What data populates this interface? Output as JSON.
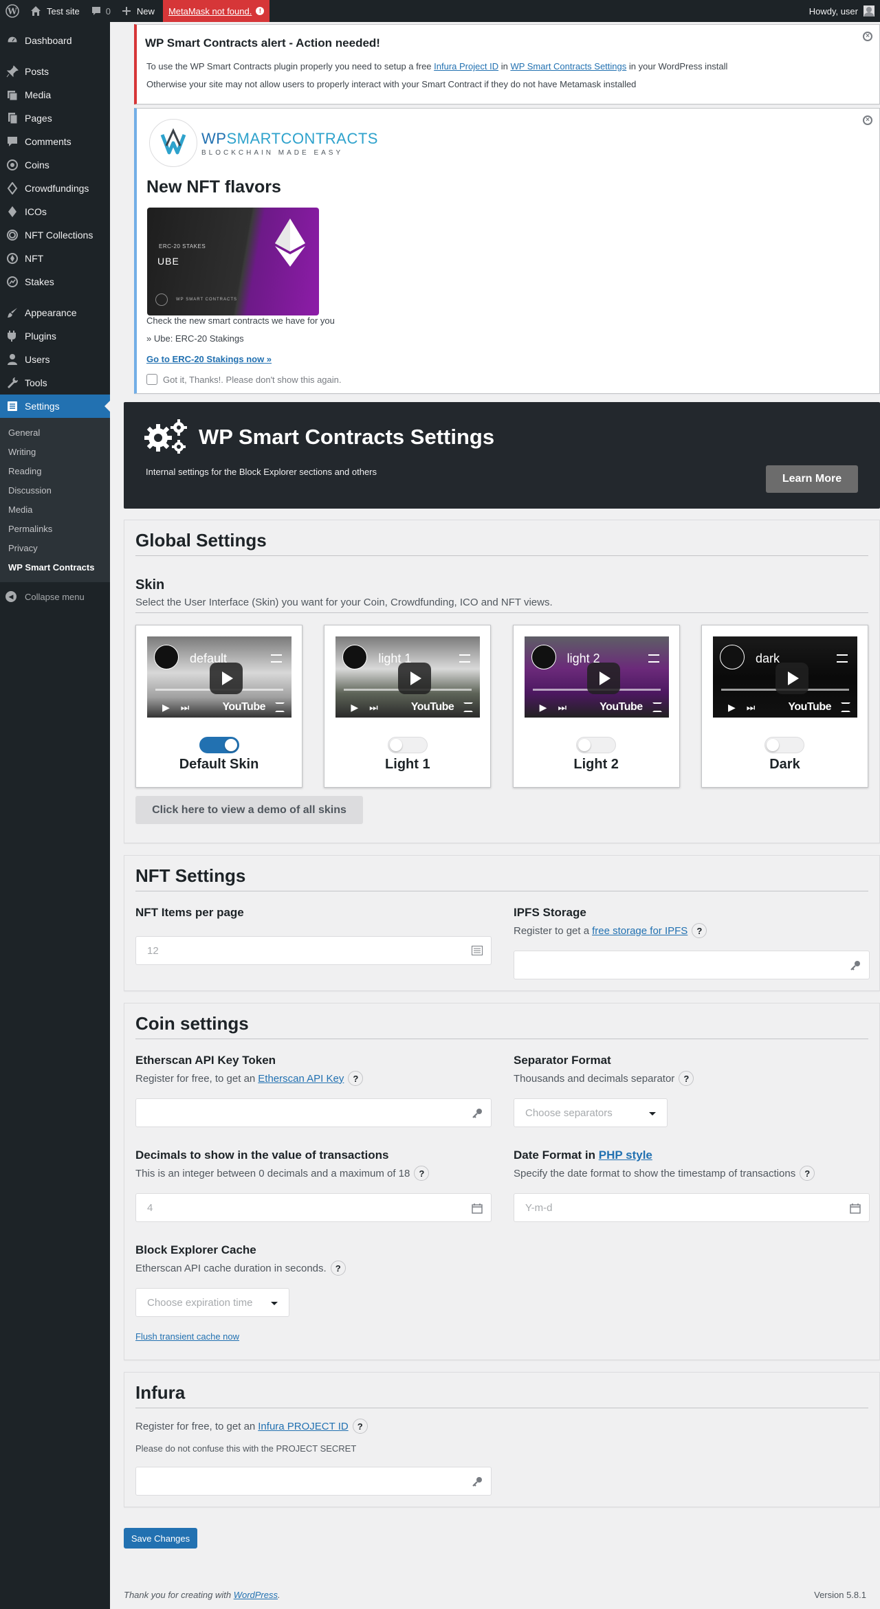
{
  "adminbar": {
    "site_name": "Test site",
    "comments_count": "0",
    "new_label": "New",
    "metamask_label": "MetaMask not found.",
    "metamask_badge": "!",
    "howdy": "Howdy, user"
  },
  "sidebar": {
    "items": [
      {
        "label": "Dashboard"
      },
      {
        "label": "Posts"
      },
      {
        "label": "Media"
      },
      {
        "label": "Pages"
      },
      {
        "label": "Comments"
      },
      {
        "label": "Coins"
      },
      {
        "label": "Crowdfundings"
      },
      {
        "label": "ICOs"
      },
      {
        "label": "NFT Collections"
      },
      {
        "label": "NFT"
      },
      {
        "label": "Stakes"
      },
      {
        "label": "Appearance"
      },
      {
        "label": "Plugins"
      },
      {
        "label": "Users"
      },
      {
        "label": "Tools"
      },
      {
        "label": "Settings"
      }
    ],
    "submenu": [
      "General",
      "Writing",
      "Reading",
      "Discussion",
      "Media",
      "Permalinks",
      "Privacy",
      "WP Smart Contracts"
    ],
    "collapse": "Collapse menu"
  },
  "alert": {
    "title": "WP Smart Contracts alert - Action needed!",
    "p1_before": "To use the WP Smart Contracts plugin properly you need to setup a free ",
    "p1_link1": "Infura Project ID",
    "p1_mid": " in ",
    "p1_link2": "WP Smart Contracts Settings",
    "p1_after": " in your WordPress install",
    "p2": "Otherwise your site may not allow users to properly interact with your Smart Contract if they do not have Metamask installed"
  },
  "promo": {
    "logo_wp": "WP",
    "logo_sc": "SMARTCONTRACTS",
    "logo_tagline": "BLOCKCHAIN MADE EASY",
    "title": "New NFT flavors",
    "card_tag": "ERC-20 STAKES",
    "card_name": "UBE",
    "card_footer": "WP SMART CONTRACTS",
    "text1": "Check the new smart contracts we have for you",
    "text2": "» Ube: ERC-20 Stakings",
    "link": "Go to ERC-20 Stakings now »",
    "dismiss_label": "Got it, Thanks!. Please don't show this again."
  },
  "hero": {
    "title": "WP Smart Contracts Settings",
    "subtitle": "Internal settings for the Block Explorer sections and others",
    "learn_more": "Learn More"
  },
  "global": {
    "title": "Global Settings",
    "skin_title": "Skin",
    "skin_desc": "Select the User Interface (Skin) you want for your Coin, Crowdfunding, ICO and NFT views.",
    "skins": [
      {
        "video_title": "default",
        "name": "Default Skin",
        "active": true
      },
      {
        "video_title": "light 1",
        "name": "Light 1",
        "active": false
      },
      {
        "video_title": "light 2",
        "name": "Light 2",
        "active": false
      },
      {
        "video_title": "dark",
        "name": "Dark",
        "active": false
      }
    ],
    "youtube": "YouTube",
    "demo_button": "Click here to view a demo of all skins"
  },
  "nft": {
    "title": "NFT Settings",
    "items_label": "NFT Items per page",
    "items_placeholder": "12",
    "ipfs_label": "IPFS Storage",
    "ipfs_desc_before": "Register to get a ",
    "ipfs_link": "free storage for IPFS"
  },
  "coin": {
    "title": "Coin settings",
    "etherscan_label": "Etherscan API Key Token",
    "etherscan_desc_before": "Register for free, to get an ",
    "etherscan_link": "Etherscan API Key",
    "separator_label": "Separator Format",
    "separator_desc": "Thousands and decimals separator",
    "separator_placeholder": "Choose separators",
    "decimals_label": "Decimals to show in the value of transactions",
    "decimals_desc": "This is an integer between 0 decimals and a maximum of 18",
    "decimals_placeholder": "4",
    "date_label_before": "Date Format in ",
    "date_label_link": "PHP style",
    "date_desc": "Specify the date format to show the timestamp of transactions",
    "date_placeholder": "Y-m-d",
    "cache_label": "Block Explorer Cache",
    "cache_desc": "Etherscan API cache duration in seconds.",
    "cache_placeholder": "Choose expiration time",
    "flush_link": "Flush transient cache now"
  },
  "infura": {
    "title": "Infura",
    "desc_before": "Register for free, to get an ",
    "desc_link": "Infura PROJECT ID",
    "note": "Please do not confuse this with the PROJECT SECRET"
  },
  "save_label": "Save Changes",
  "footer": {
    "thanks_before": "Thank you for creating with ",
    "thanks_link": "WordPress",
    "thanks_after": ".",
    "version": "Version 5.8.1"
  },
  "help_glyph": "?",
  "colors": {
    "accent": "#2271b1",
    "adminbar": "#1d2327",
    "alert": "#d63638",
    "hero": "#23282d"
  }
}
